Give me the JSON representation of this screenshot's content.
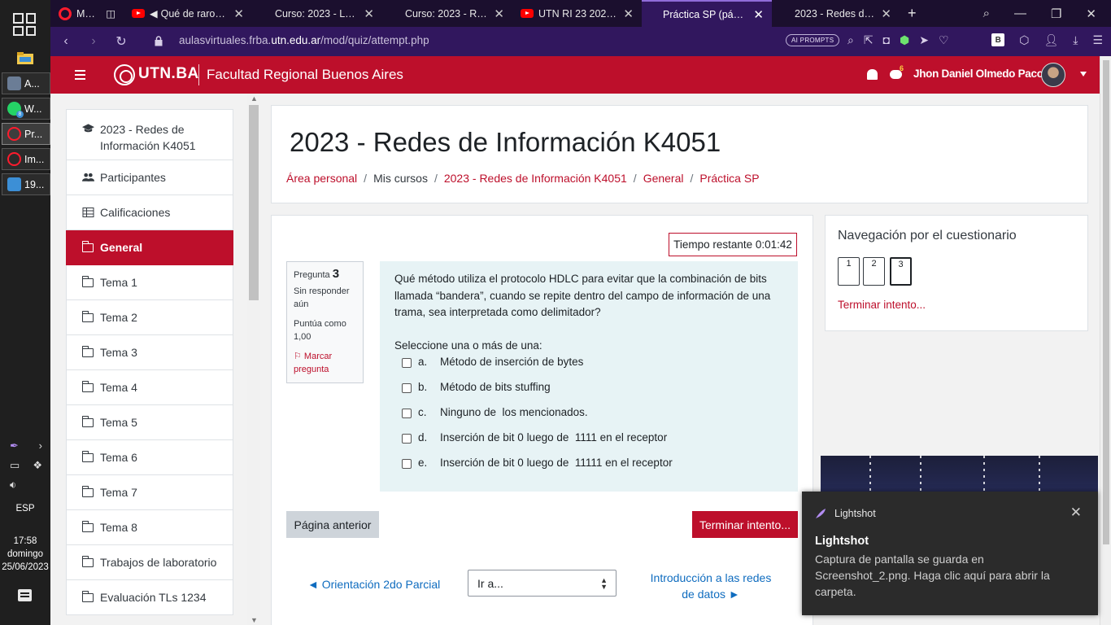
{
  "taskbar": {
    "items": [
      {
        "label": "A...",
        "color": "#6b7d96"
      },
      {
        "label": "W...",
        "color": "#25d366"
      },
      {
        "label": "Pr...",
        "color": "#ff1b2d"
      },
      {
        "label": "Im...",
        "color": "#ff1b2d"
      },
      {
        "label": "19...",
        "color": "#3c8fd6"
      }
    ],
    "whatsapp_badge": "8",
    "language": "ESP",
    "time": "17:58",
    "day": "domingo",
    "date": "25/06/2023"
  },
  "browser": {
    "menu_label": "Menú",
    "tabs": [
      {
        "label": "Qué de raro tien",
        "icon": "youtube-icon"
      },
      {
        "label": "Curso: 2023 - Labor",
        "icon": "moodle-icon"
      },
      {
        "label": "Curso: 2023 - Redes",
        "icon": "moodle-icon"
      },
      {
        "label": "UTN RI 23 2021 06 1",
        "icon": "youtube-icon"
      },
      {
        "label": "Práctica SP (página 3",
        "icon": "moodle-icon"
      },
      {
        "label": "2023 - Redes de Info",
        "icon": "moodle-icon"
      }
    ],
    "url_prefix": "aulasvirtuales.frba.",
    "url_domain": "utn.edu.ar",
    "url_path": "/mod/quiz/attempt.php",
    "ai_prompts_label": "AI PROMPTS",
    "ext_b_label": "B"
  },
  "site": {
    "brand": "UTN.BA",
    "faculty": "Facultad Regional Buenos Aires",
    "user_name": "Jhon Daniel Olmedo Paco",
    "messages_badge": "6",
    "accent_color": "#bd0f2b"
  },
  "sidebar": {
    "items": [
      {
        "label": "2023 - Redes de Información K4051",
        "icon": "graduation-cap-icon"
      },
      {
        "label": "Participantes",
        "icon": "users-icon"
      },
      {
        "label": "Calificaciones",
        "icon": "table-icon"
      },
      {
        "label": "General",
        "icon": "folder-icon"
      },
      {
        "label": "Tema 1",
        "icon": "folder-icon"
      },
      {
        "label": "Tema 2",
        "icon": "folder-icon"
      },
      {
        "label": "Tema 3",
        "icon": "folder-icon"
      },
      {
        "label": "Tema 4",
        "icon": "folder-icon"
      },
      {
        "label": "Tema 5",
        "icon": "folder-icon"
      },
      {
        "label": "Tema 6",
        "icon": "folder-icon"
      },
      {
        "label": "Tema 7",
        "icon": "folder-icon"
      },
      {
        "label": "Tema 8",
        "icon": "folder-icon"
      },
      {
        "label": "Trabajos de laboratorio",
        "icon": "folder-icon"
      },
      {
        "label": "Evaluación TLs 1234",
        "icon": "folder-icon"
      }
    ]
  },
  "header": {
    "title": "2023 - Redes de Información K4051",
    "breadcrumb": [
      "Área personal",
      "Mis cursos",
      "2023 - Redes de Información K4051",
      "General",
      "Práctica SP"
    ]
  },
  "quiz": {
    "timer": "Tiempo restante 0:01:42",
    "question_label": "Pregunta",
    "question_number": "3",
    "status": "Sin responder aún",
    "points": "Puntúa como 1,00",
    "flag_label": "Marcar pregunta",
    "question_text": "Qué método utiliza el protocolo HDLC para evitar que la combinación de bits llamada “bandera”, cuando se repite dentro del campo de información de una trama, sea interpretada como delimitador?",
    "prompt": "Seleccione una o más de una:",
    "options": [
      {
        "letter": "a.",
        "text": "Método de inserción de bytes"
      },
      {
        "letter": "b.",
        "text": "Método de bits stuffing"
      },
      {
        "letter": "c.",
        "text": "Ninguno de  los mencionados."
      },
      {
        "letter": "d.",
        "text": "Inserción de bit 0 luego de  1111 en el receptor"
      },
      {
        "letter": "e.",
        "text": "Inserción de bit 0 luego de  11111 en el receptor"
      }
    ],
    "prev_page": "Página anterior",
    "finish": "Terminar intento...",
    "prev_activity": "◄ Orientación 2do Parcial",
    "goto_placeholder": "Ir a...",
    "next_activity": "Introducción a las redes de datos ►"
  },
  "quiz_nav": {
    "title": "Navegación por el cuestionario",
    "buttons": [
      "1",
      "2",
      "3"
    ],
    "current": "3",
    "finish": "Terminar intento..."
  },
  "toast": {
    "app": "Lightshot",
    "title": "Lightshot",
    "body": "Captura de pantalla se guarda en Screenshot_2.png. Haga clic aquí para abrir la carpeta."
  }
}
